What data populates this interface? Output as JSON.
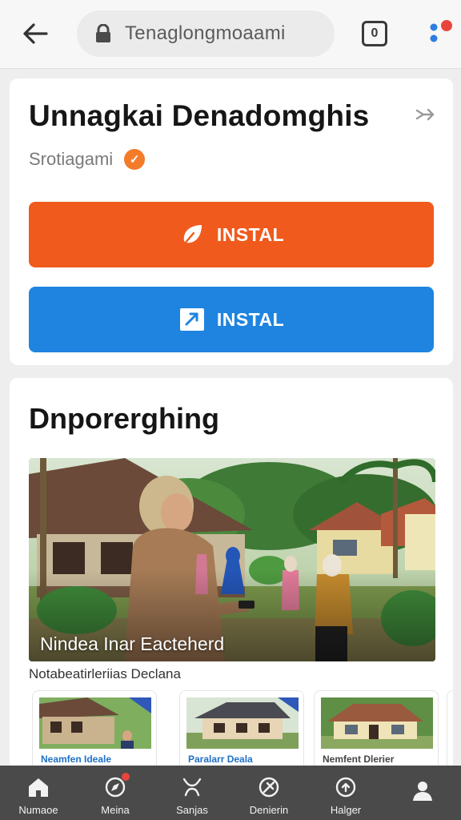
{
  "browser": {
    "url": "Tenaglongmoaami",
    "tabs_count": "0"
  },
  "app": {
    "title": "Unnagkai Denadomghis",
    "developer": "Srotiagami",
    "verified_mark": "✓",
    "buttons": [
      {
        "label": "INSTAL",
        "color": "#f05a1c",
        "icon": "leaf-icon"
      },
      {
        "label": "INSTAL",
        "color": "#1e84e0",
        "icon": "window-icon"
      }
    ]
  },
  "section": {
    "title": "Dnporerghing",
    "hero_caption": "Nindea Inar Eacteherd",
    "sub_caption": "Notabeatirleriias Declana",
    "thumbnails": [
      {
        "label": "Neamfen Ideale",
        "label_color": "#1e6fc7"
      },
      {
        "label": "Paralarr Deala",
        "label_color": "#1e6fc7"
      },
      {
        "label": "Nemfent Dlerier",
        "label_color": "#444444"
      }
    ]
  },
  "nav": {
    "items": [
      {
        "label": "Numaoe",
        "icon": "home-icon"
      },
      {
        "label": "Meina",
        "icon": "compass-icon",
        "badge": true
      },
      {
        "label": "Sanjas",
        "icon": "bell-icon"
      },
      {
        "label": "Denierin",
        "icon": "globe-icon"
      },
      {
        "label": "Halger",
        "icon": "update-icon"
      },
      {
        "label": "",
        "icon": "profile-icon"
      }
    ]
  },
  "colors": {
    "accent_orange": "#f05a1c",
    "accent_blue": "#1e84e0",
    "verified": "#f47b2a",
    "nav_bg": "#4a4a4a"
  }
}
